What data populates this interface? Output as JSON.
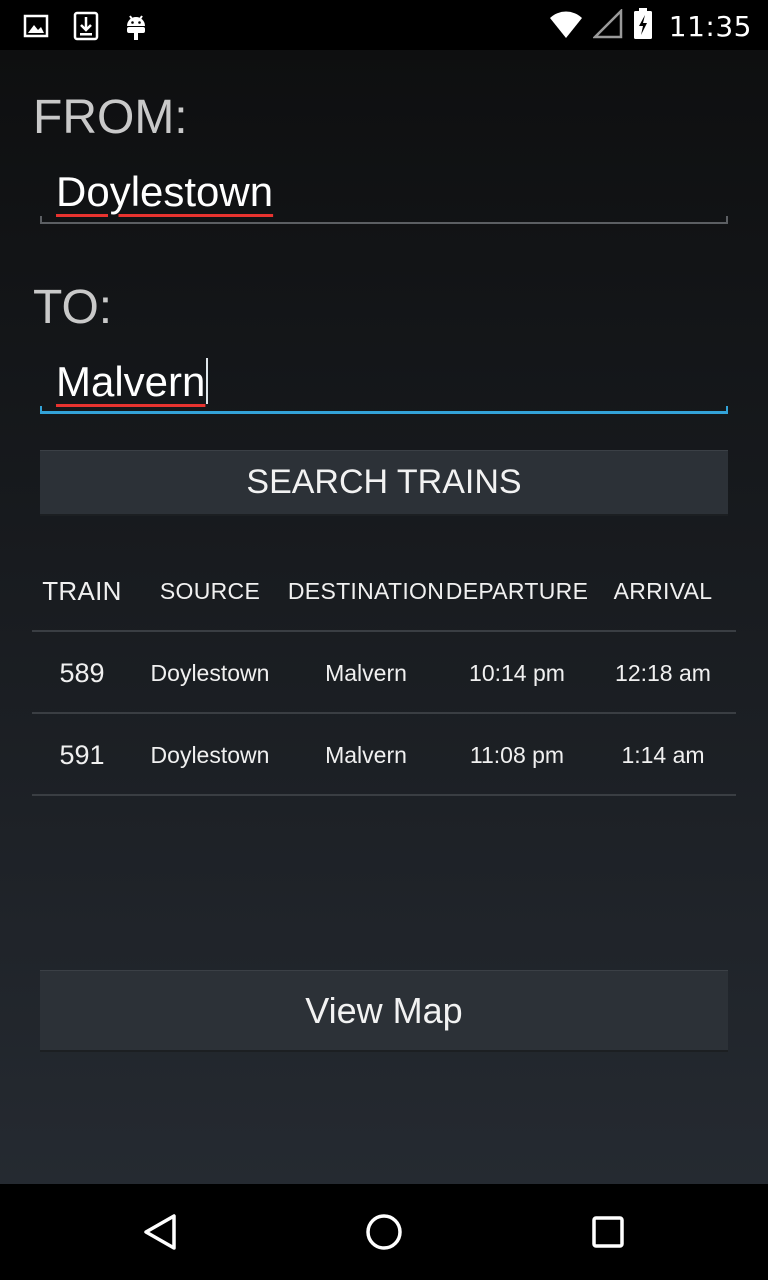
{
  "status_bar": {
    "time": "11:35",
    "left_icons": [
      "image-icon",
      "download-icon",
      "android-icon"
    ],
    "right_icons": [
      "wifi-icon",
      "cell-signal-icon",
      "battery-charging-icon"
    ]
  },
  "form": {
    "from_label": "FROM:",
    "from_value": "Doylestown",
    "to_label": "TO:",
    "to_value": "Malvern",
    "search_button": "SEARCH TRAINS"
  },
  "table": {
    "headers": {
      "train": "TRAIN",
      "source": "SOURCE",
      "destination": "DESTINATION",
      "departure": "DEPARTURE",
      "arrival": "ARRIVAL"
    },
    "rows": [
      {
        "train": "589",
        "source": "Doylestown",
        "destination": "Malvern",
        "departure": "10:14 pm",
        "arrival": "12:18 am"
      },
      {
        "train": "591",
        "source": "Doylestown",
        "destination": "Malvern",
        "departure": "11:08 pm",
        "arrival": "1:14 am"
      }
    ]
  },
  "view_map_button": "View Map",
  "colors": {
    "accent": "#33a3d8",
    "spell_underline": "#e8332f",
    "button_bg": "#2c3137"
  },
  "nav_bar": {
    "icons": [
      "back-icon",
      "home-icon",
      "recents-icon"
    ]
  }
}
